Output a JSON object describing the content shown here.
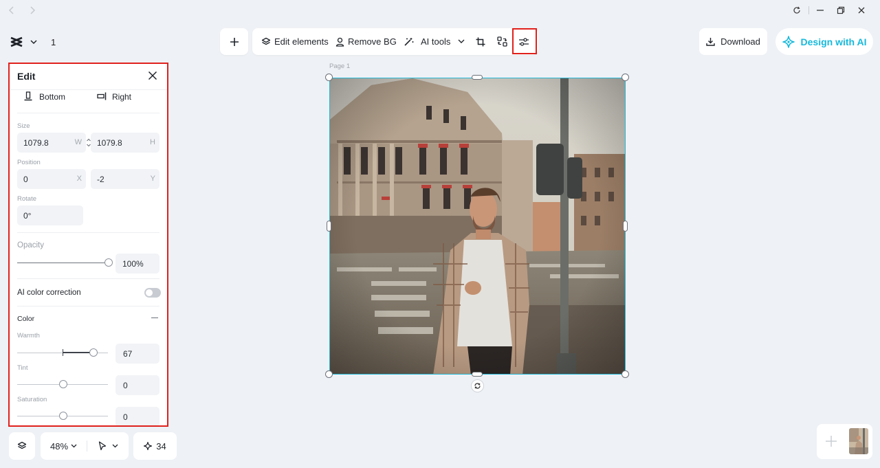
{
  "toolbar": {
    "edit_elements": "Edit elements",
    "remove_bg": "Remove BG",
    "ai_tools": "AI tools"
  },
  "header": {
    "page_count": "1",
    "download_label": "Download",
    "design_ai_label": "Design with AI"
  },
  "edit_panel": {
    "title": "Edit",
    "align_bottom": "Bottom",
    "align_right": "Right",
    "size_label": "Size",
    "size_w": "1079.8",
    "size_w_unit": "W",
    "size_h": "1079.8",
    "size_h_unit": "H",
    "position_label": "Position",
    "pos_x": "0",
    "pos_x_unit": "X",
    "pos_y": "-2",
    "pos_y_unit": "Y",
    "rotate_label": "Rotate",
    "rotate_value": "0°",
    "opacity_label": "Opacity",
    "opacity_value": "100%",
    "opacity_fraction": 1.0,
    "ai_color_label": "AI color correction",
    "ai_color_on": false,
    "color_label": "Color",
    "warmth_label": "Warmth",
    "warmth_value": "67",
    "tint_label": "Tint",
    "tint_value": "0",
    "saturation_label": "Saturation",
    "saturation_value": "0"
  },
  "canvas": {
    "page_label": "Page 1"
  },
  "bottom_bar": {
    "zoom": "48%",
    "credits": "34"
  },
  "colors": {
    "accent": "#17b9dc",
    "highlight": "#e0201c",
    "selection": "#22b8d6"
  }
}
